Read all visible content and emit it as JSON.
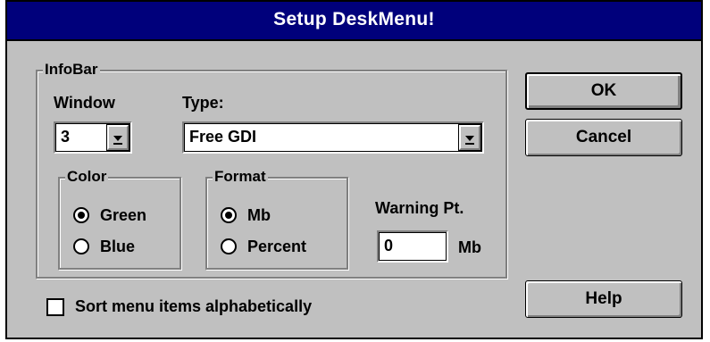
{
  "window": {
    "title": "Setup DeskMenu!"
  },
  "infobar": {
    "group_label": "InfoBar",
    "window_label": "Window",
    "window_value": "3",
    "type_label": "Type:",
    "type_value": "Free GDI"
  },
  "color_group": {
    "label": "Color",
    "options": [
      {
        "label": "Green",
        "selected": true
      },
      {
        "label": "Blue",
        "selected": false
      }
    ]
  },
  "format_group": {
    "label": "Format",
    "options": [
      {
        "label": "Mb",
        "selected": true
      },
      {
        "label": "Percent",
        "selected": false
      }
    ]
  },
  "warning": {
    "label": "Warning Pt.",
    "value": "0",
    "unit": "Mb"
  },
  "buttons": {
    "ok": "OK",
    "cancel": "Cancel",
    "help": "Help"
  },
  "sort_checkbox": {
    "label": "Sort menu items alphabetically",
    "checked": false
  },
  "colors": {
    "title_bar": "#00007b",
    "dialog_face": "#c0c0c0"
  }
}
